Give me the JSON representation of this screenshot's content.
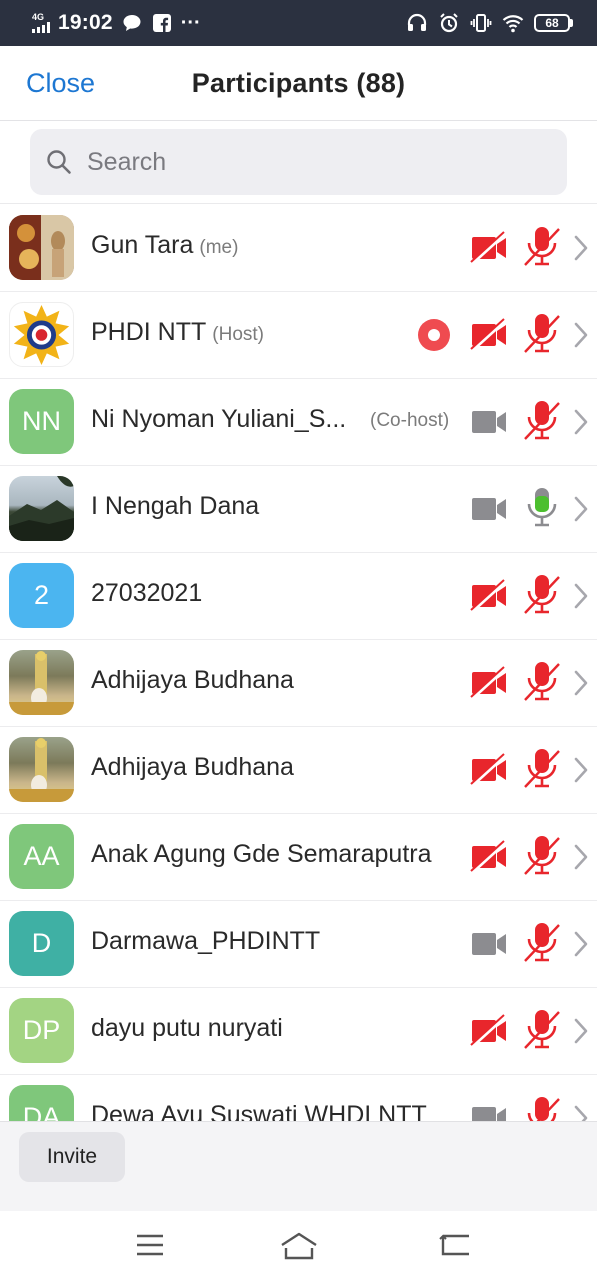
{
  "status_bar": {
    "network": "4G",
    "time": "19:02",
    "notif_icons": [
      "chat-bubble-icon",
      "facebook-icon",
      "more-dots-icon"
    ],
    "more_dots": "···",
    "right_icons": [
      "headset-icon",
      "alarm-icon",
      "vibrate-icon",
      "wifi-icon"
    ],
    "battery": "68"
  },
  "header": {
    "close_label": "Close",
    "title": "Participants (88)"
  },
  "search": {
    "placeholder": "Search"
  },
  "participants": [
    {
      "name": "Gun Tara",
      "tag": "(me)",
      "avatar": "photo",
      "camera": "off",
      "mic": "muted",
      "recording": false
    },
    {
      "name": "PHDI NTT",
      "tag": "(Host)",
      "avatar": "logo",
      "camera": "off",
      "mic": "muted",
      "recording": true
    },
    {
      "name": "Ni Nyoman Yuliani_S...",
      "tag": "(Co-host)",
      "avatar_initials": "NN",
      "avatar_color": "#7fc77b",
      "camera": "on",
      "mic": "muted",
      "recording": false
    },
    {
      "name": "I Nengah Dana",
      "tag": "",
      "avatar": "photo",
      "camera": "on",
      "mic": "on",
      "recording": false
    },
    {
      "name": "27032021",
      "tag": "",
      "avatar_initials": "2",
      "avatar_color": "#4bb5f0",
      "camera": "off",
      "mic": "muted",
      "recording": false
    },
    {
      "name": "Adhijaya Budhana",
      "tag": "",
      "avatar": "photo",
      "camera": "off",
      "mic": "muted",
      "recording": false
    },
    {
      "name": "Adhijaya Budhana",
      "tag": "",
      "avatar": "photo",
      "camera": "off",
      "mic": "muted",
      "recording": false
    },
    {
      "name": "Anak Agung Gde Semaraputra",
      "tag": "",
      "avatar_initials": "AA",
      "avatar_color": "#7fc77b",
      "camera": "off",
      "mic": "muted",
      "recording": false
    },
    {
      "name": "Darmawa_PHDINTT",
      "tag": "",
      "avatar_initials": "D",
      "avatar_color": "#3fb0a4",
      "camera": "on",
      "mic": "muted",
      "recording": false
    },
    {
      "name": "dayu putu nuryati",
      "tag": "",
      "avatar_initials": "DP",
      "avatar_color": "#a3d483",
      "camera": "off",
      "mic": "muted",
      "recording": false
    },
    {
      "name": "Dewa Ayu Suswati WHDI NTT",
      "tag": "",
      "avatar_initials": "DA",
      "avatar_color": "#7fc77b",
      "camera": "on",
      "mic": "muted",
      "recording": false
    }
  ],
  "footer": {
    "invite_label": "Invite"
  },
  "nav_bar": [
    "menu-icon",
    "home-icon",
    "back-icon"
  ],
  "colors": {
    "accent": "#1d77d2",
    "muted_red": "#e8262c",
    "mic_on_green": "#4cbf2f",
    "icon_gray": "#8c8c90",
    "status_bar_bg": "#2b3140"
  }
}
